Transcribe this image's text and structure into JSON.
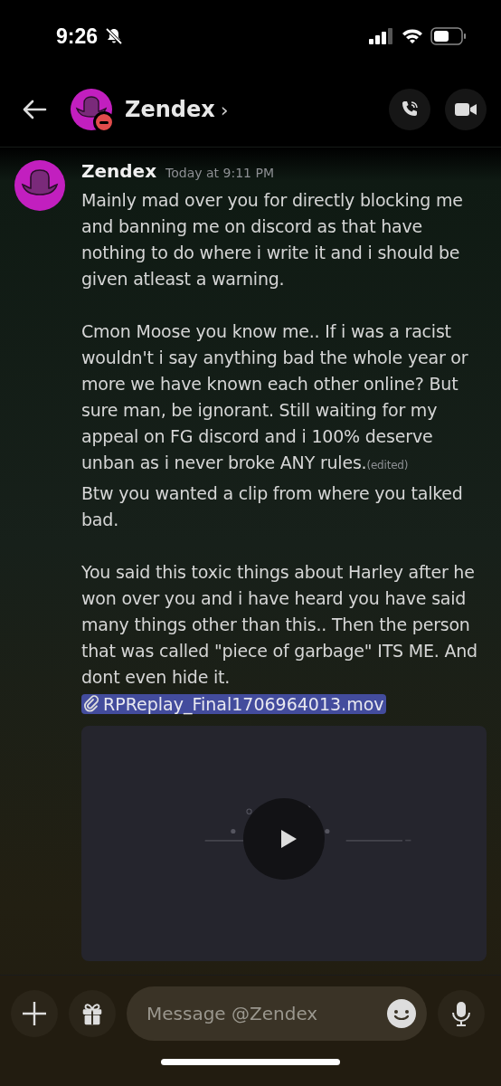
{
  "status_bar": {
    "time": "9:26"
  },
  "header": {
    "title": "Zendex",
    "chevron": "›",
    "do_not_disturb": true
  },
  "messages": [
    {
      "author": "Zendex",
      "timestamp": "Today at 9:11 PM",
      "paragraphs": [
        "Mainly mad over you for directly blocking me and banning me on discord as that have nothing to do where i write it and i should be given atleast a warning.",
        "Cmon Moose you know me.. If i was a racist wouldn't i say anything bad the whole year or more we have known each other online? But sure man, be ignorant. Still waiting for my appeal on FG discord and i 100% deserve unban as i never broke ANY rules."
      ],
      "edited": "(edited)"
    },
    {
      "paragraphs": [
        "Btw you wanted a clip from where you talked bad.",
        "You said this toxic things about Harley after he won over you and i have heard you have said many things other than this.. Then the person that was called \"piece of garbage\" ITS ME. And dont even hide it."
      ],
      "attachment": {
        "filename": "RPReplay_Final1706964013.mov",
        "selected": true,
        "kind": "video"
      }
    }
  ],
  "composer": {
    "placeholder": "Message @Zendex"
  }
}
